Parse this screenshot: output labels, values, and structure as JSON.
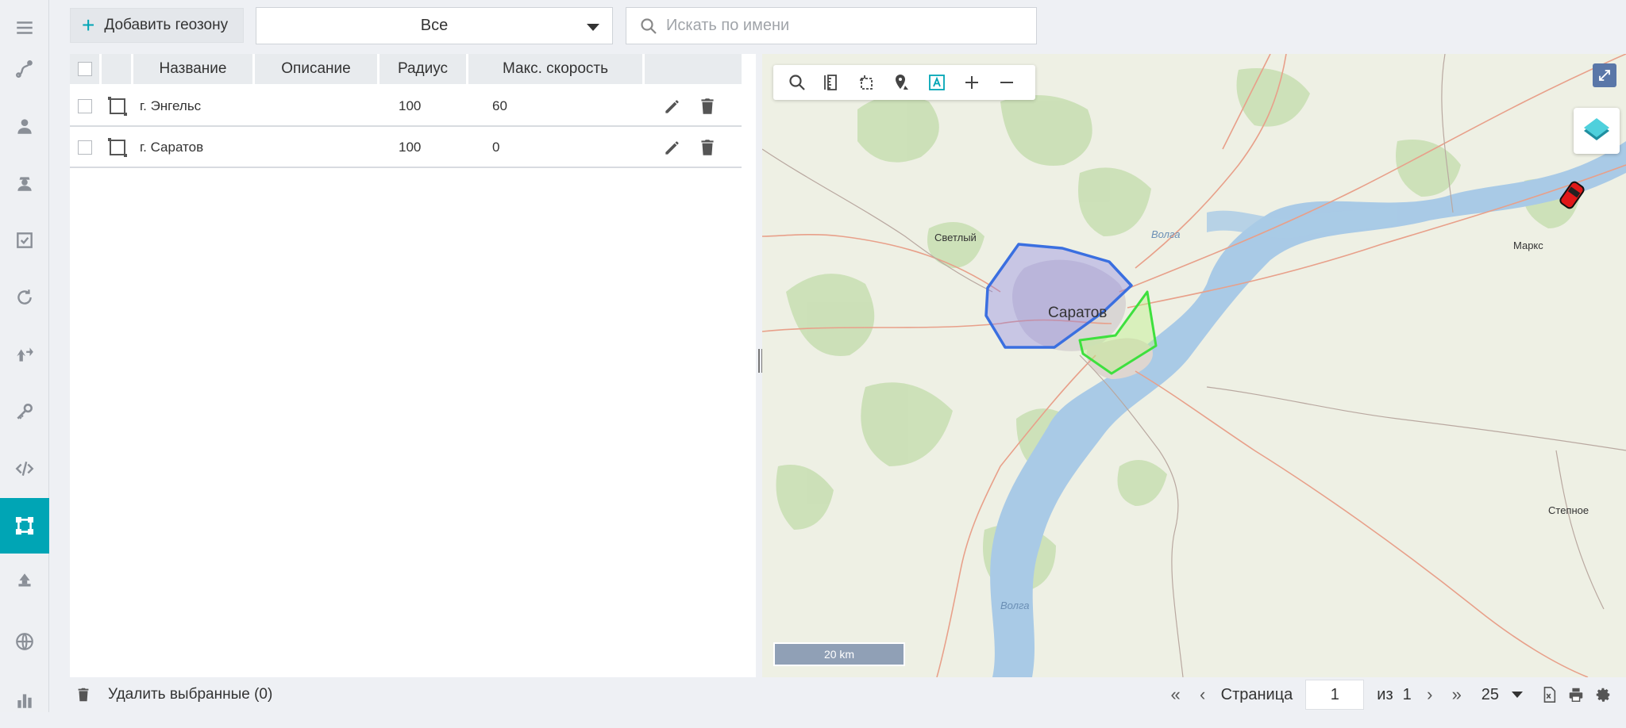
{
  "sidebar": {
    "items": [
      {
        "icon": "menu-icon"
      },
      {
        "icon": "track-icon"
      },
      {
        "icon": "user-icon"
      },
      {
        "icon": "driver-icon"
      },
      {
        "icon": "task-checkbox-icon"
      },
      {
        "icon": "refresh-icon"
      },
      {
        "icon": "route-icon"
      },
      {
        "icon": "key-icon"
      },
      {
        "icon": "code-icon"
      },
      {
        "icon": "geofence-icon",
        "active": true
      },
      {
        "icon": "pin-icon"
      },
      {
        "icon": "globe-icon"
      },
      {
        "icon": "bar-chart-icon"
      }
    ]
  },
  "toolbar": {
    "add_label": "Добавить геозону",
    "filter_value": "Все",
    "search_placeholder": "Искать по имени"
  },
  "table": {
    "columns": [
      "Название",
      "Описание",
      "Радиус",
      "Макс. скорость"
    ],
    "rows": [
      {
        "name": "г. Энгельс",
        "description": "",
        "radius": "100",
        "max_speed": "60"
      },
      {
        "name": "г. Саратов",
        "description": "",
        "radius": "100",
        "max_speed": "0"
      }
    ]
  },
  "map": {
    "labels": {
      "svetly": "Светлый",
      "saratov": "Саратов",
      "volga_1": "Волга",
      "volga_2": "Волга",
      "marks": "Маркс",
      "stepnoe": "Степное"
    },
    "scale": "20 km",
    "colors": {
      "zone_blue": "#3a6fe0",
      "zone_green": "#3ee03e",
      "water": "#a9cae6",
      "accent": "#00a5b5"
    }
  },
  "footer": {
    "delete_label": "Удалить выбранные (0)",
    "page_label": "Страница",
    "page_value": "1",
    "of_label": "из",
    "total_pages": "1",
    "page_size": "25"
  }
}
